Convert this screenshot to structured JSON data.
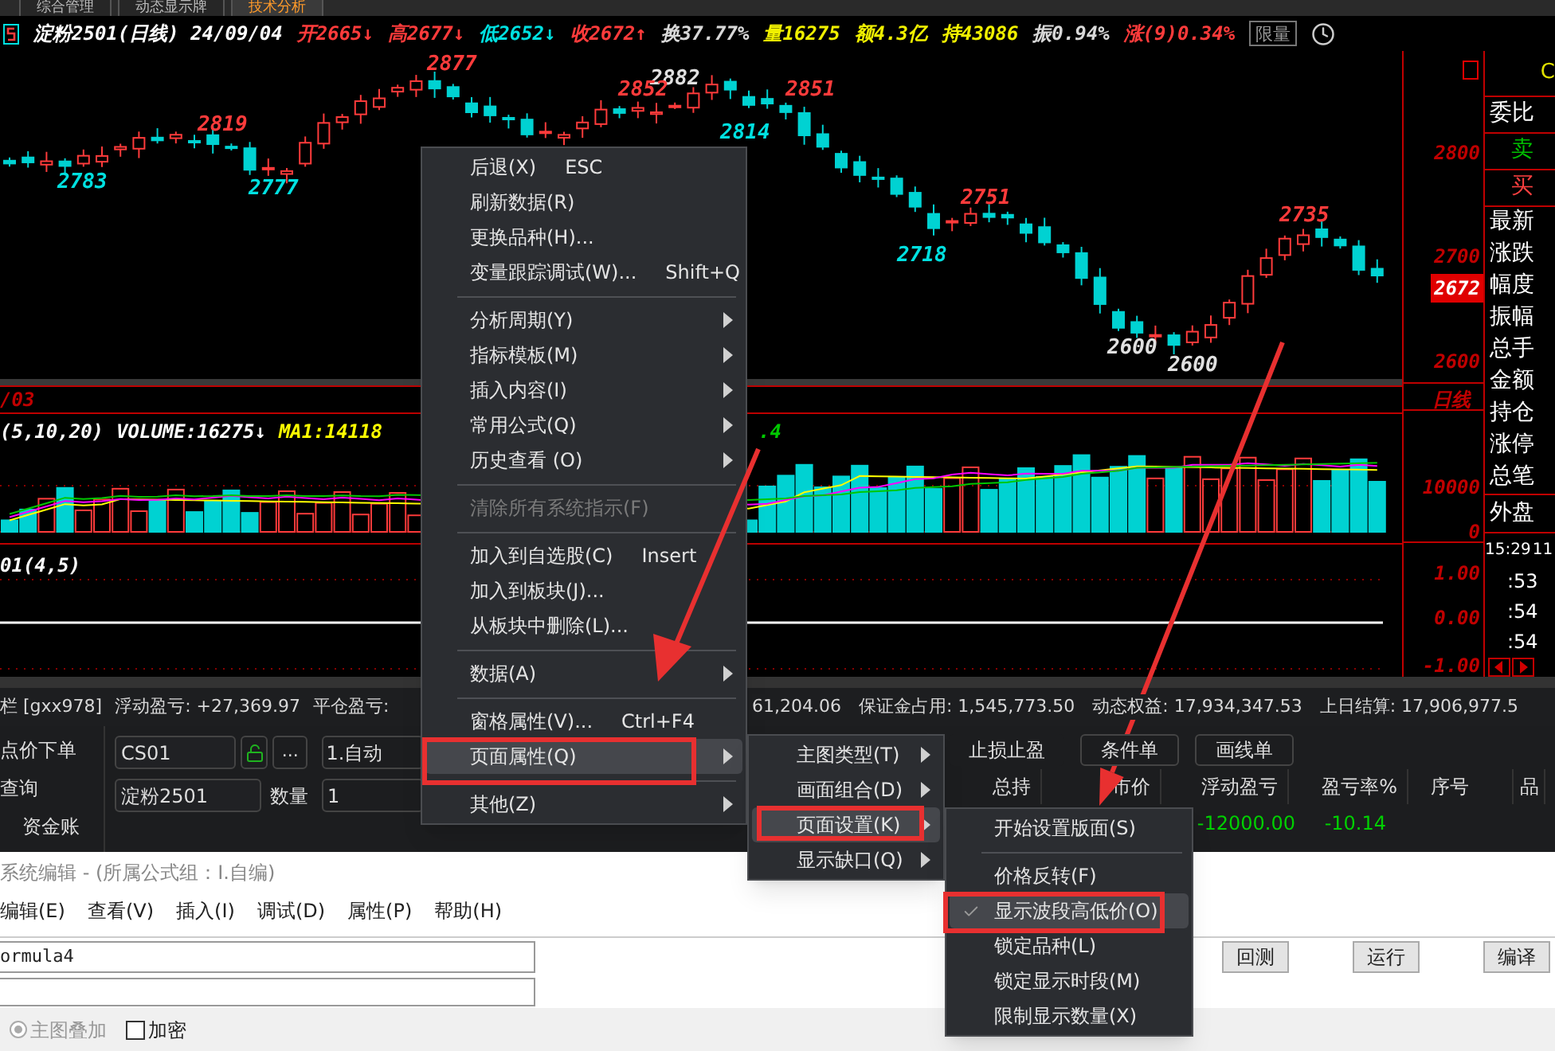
{
  "top_tabs": [
    {
      "label": "综合管理",
      "selected": false
    },
    {
      "label": "动态显示牌",
      "selected": false
    },
    {
      "label": "技术分析",
      "selected": true
    }
  ],
  "quote_header": {
    "title": "淀粉2501(日线) 24/09/04",
    "fields": [
      {
        "text": "开2665↓",
        "color": "#ff3b3b"
      },
      {
        "text": "高2677↓",
        "color": "#ff3b3b"
      },
      {
        "text": "低2652↓",
        "color": "#00e0e0"
      },
      {
        "text": "收2672↑",
        "color": "#ff3b3b"
      },
      {
        "text": "换37.77%",
        "color": "#d8d8d8"
      },
      {
        "text": "量16275",
        "color": "#f0f000"
      },
      {
        "text": "额4.3亿",
        "color": "#f0f000"
      },
      {
        "text": "持43086",
        "color": "#f0f000"
      },
      {
        "text": "振0.94%",
        "color": "#d8d8d8"
      },
      {
        "text": "涨(9)0.34%",
        "color": "#ff3b3b"
      }
    ],
    "button": "限量"
  },
  "price_chart": {
    "swing_labels": [
      {
        "text": "2877",
        "color": "#ff3b3b"
      },
      {
        "text": "2882",
        "color": "#e0e0e0"
      },
      {
        "text": "2852",
        "color": "#ff3b3b"
      },
      {
        "text": "2851",
        "color": "#ff3b3b"
      },
      {
        "text": "2819",
        "color": "#ff3b3b"
      },
      {
        "text": "2814",
        "color": "#00e0e0"
      },
      {
        "text": "2783",
        "color": "#00e0e0"
      },
      {
        "text": "2777",
        "color": "#00e0e0"
      },
      {
        "text": "2751",
        "color": "#ff3b3b"
      },
      {
        "text": "2735",
        "color": "#ff3b3b"
      },
      {
        "text": "2718",
        "color": "#00e0e0"
      },
      {
        "text": "2600",
        "color": "#e0e0e0"
      },
      {
        "text": "2600",
        "color": "#e0e0e0"
      }
    ],
    "axis": [
      "2800",
      "2700",
      "2600"
    ],
    "last_price": "2672"
  },
  "volume_panel": {
    "date": "/03",
    "period": "日线",
    "legend": [
      {
        "text": "(5,10,20)",
        "color": "#ffffff"
      },
      {
        "text": "VOLUME:16275↓",
        "color": "#ffffff"
      },
      {
        "text": "MA1:14118",
        "color": "#ffff00"
      },
      {
        "text": ".4",
        "color": "#00c800"
      }
    ],
    "axis": [
      "10000",
      "0"
    ]
  },
  "indicator_panel": {
    "title": "01(4,5)",
    "axis": [
      "1.00",
      "0.00",
      "-1.00"
    ]
  },
  "info_panel": {
    "top": "C",
    "rows": [
      {
        "label": "委比",
        "kind": "plain"
      },
      {
        "label": "卖",
        "kind": "sell"
      },
      {
        "label": "买",
        "kind": "buy"
      },
      {
        "label": "最新",
        "kind": "plain"
      },
      {
        "label": "涨跌",
        "kind": "plain"
      },
      {
        "label": "幅度",
        "kind": "plain"
      },
      {
        "label": "振幅",
        "kind": "plain"
      },
      {
        "label": "总手",
        "kind": "plain"
      },
      {
        "label": "金额",
        "kind": "plain"
      },
      {
        "label": "持仓",
        "kind": "plain"
      },
      {
        "label": "涨停",
        "kind": "plain"
      },
      {
        "label": "总笔",
        "kind": "plain"
      },
      {
        "label": "外盘",
        "kind": "plain"
      }
    ],
    "time": "15:29",
    "time_extra": "11",
    "ticks": [
      ":53",
      ":54",
      ":54"
    ]
  },
  "account_bar": [
    "栏 [gxx978]",
    "浮动盈亏: +27,369.97",
    "平仓盈亏:",
    "61,204.06",
    "保证金占用: 1,545,773.50",
    "动态权益: 17,934,347.53",
    "上日结算: 17,906,977.5"
  ],
  "trade_panel": {
    "nav": [
      "点价下单",
      "查询",
      "资金账"
    ],
    "code": "CS01",
    "more": "...",
    "mode": "1.自动",
    "contract": "淀粉2501",
    "quantity_label": "数量",
    "quantity": "1",
    "tabs": [
      "止损止盈",
      "条件单",
      "画线单"
    ],
    "columns": [
      "总持",
      "市价",
      "浮动盈亏",
      "盈亏率%"
    ],
    "row": {
      "floating_pl": "-12000.00",
      "pl_rate": "-10.14"
    },
    "order_columns": [
      "序号",
      "品"
    ]
  },
  "formula_editor": {
    "title": "系统编辑 - (所属公式组：I.自编)",
    "menu": [
      "编辑(E)",
      "查看(V)",
      "插入(I)",
      "调试(D)",
      "属性(P)",
      "帮助(H)"
    ],
    "name": "ormula4",
    "buttons": [
      "回测",
      "运行",
      "编译"
    ],
    "overlay": {
      "label": "主图叠加",
      "checked": true,
      "disabled": true
    },
    "encrypt": {
      "label": "加密",
      "checked": false,
      "disabled": false
    }
  },
  "context_menu": [
    {
      "kind": "item",
      "label": "后退(X)",
      "shortcut": "ESC",
      "submenu": false,
      "disabled": false,
      "selected": false
    },
    {
      "kind": "item",
      "label": "刷新数据(R)",
      "submenu": false,
      "disabled": false,
      "selected": false
    },
    {
      "kind": "item",
      "label": "更换品种(H)...",
      "submenu": false,
      "disabled": false,
      "selected": false
    },
    {
      "kind": "item",
      "label": "变量跟踪调试(W)...",
      "shortcut": "Shift+Q",
      "submenu": false,
      "disabled": false,
      "selected": false
    },
    {
      "kind": "separator"
    },
    {
      "kind": "item",
      "label": "分析周期(Y)",
      "submenu": true,
      "disabled": false,
      "selected": false
    },
    {
      "kind": "item",
      "label": "指标模板(M)",
      "submenu": true,
      "disabled": false,
      "selected": false
    },
    {
      "kind": "item",
      "label": "插入内容(I)",
      "submenu": true,
      "disabled": false,
      "selected": false
    },
    {
      "kind": "item",
      "label": "常用公式(Q)",
      "submenu": true,
      "disabled": false,
      "selected": false
    },
    {
      "kind": "item",
      "label": "历史查看 (O)",
      "submenu": true,
      "disabled": false,
      "selected": false
    },
    {
      "kind": "separator"
    },
    {
      "kind": "item",
      "label": "清除所有系统指示(F)",
      "submenu": false,
      "disabled": true,
      "selected": false
    },
    {
      "kind": "separator"
    },
    {
      "kind": "item",
      "label": "加入到自选股(C)",
      "shortcut": "Insert",
      "submenu": false,
      "disabled": false,
      "selected": false
    },
    {
      "kind": "item",
      "label": "加入到板块(J)...",
      "submenu": false,
      "disabled": false,
      "selected": false
    },
    {
      "kind": "item",
      "label": "从板块中删除(L)...",
      "submenu": false,
      "disabled": false,
      "selected": false
    },
    {
      "kind": "separator"
    },
    {
      "kind": "item",
      "label": "数据(A)",
      "submenu": true,
      "disabled": false,
      "selected": false
    },
    {
      "kind": "separator"
    },
    {
      "kind": "item",
      "label": "窗格属性(V)...",
      "shortcut": "Ctrl+F4",
      "submenu": false,
      "disabled": false,
      "selected": false
    },
    {
      "kind": "item",
      "label": "页面属性(Q)",
      "submenu": true,
      "disabled": false,
      "selected": true
    },
    {
      "kind": "separator"
    },
    {
      "kind": "item",
      "label": "其他(Z)",
      "submenu": true,
      "disabled": false,
      "selected": false
    }
  ],
  "page_submenu": [
    {
      "kind": "item",
      "label": "主图类型(T)",
      "submenu": true,
      "disabled": false,
      "selected": false
    },
    {
      "kind": "item",
      "label": "画面组合(D)",
      "submenu": true,
      "disabled": false,
      "selected": false
    },
    {
      "kind": "item",
      "label": "页面设置(K)",
      "submenu": true,
      "disabled": false,
      "selected": true
    },
    {
      "kind": "item",
      "label": "显示缺口(Q)",
      "submenu": true,
      "disabled": false,
      "selected": false
    }
  ],
  "layout_submenu": [
    {
      "kind": "item",
      "label": "开始设置版面(S)",
      "submenu": false,
      "disabled": false,
      "selected": false,
      "checked": false
    },
    {
      "kind": "separator"
    },
    {
      "kind": "item",
      "label": "价格反转(F)",
      "submenu": false,
      "disabled": false,
      "selected": false,
      "checked": false
    },
    {
      "kind": "item",
      "label": "显示波段高低价(O)",
      "submenu": false,
      "disabled": false,
      "selected": true,
      "checked": true
    },
    {
      "kind": "item",
      "label": "锁定品种(L)",
      "submenu": false,
      "disabled": false,
      "selected": false,
      "checked": false
    },
    {
      "kind": "item",
      "label": "锁定显示时段(M)",
      "submenu": false,
      "disabled": false,
      "selected": false,
      "checked": false
    },
    {
      "kind": "item",
      "label": "限制显示数量(X)",
      "submenu": false,
      "disabled": false,
      "selected": false,
      "checked": false
    }
  ]
}
